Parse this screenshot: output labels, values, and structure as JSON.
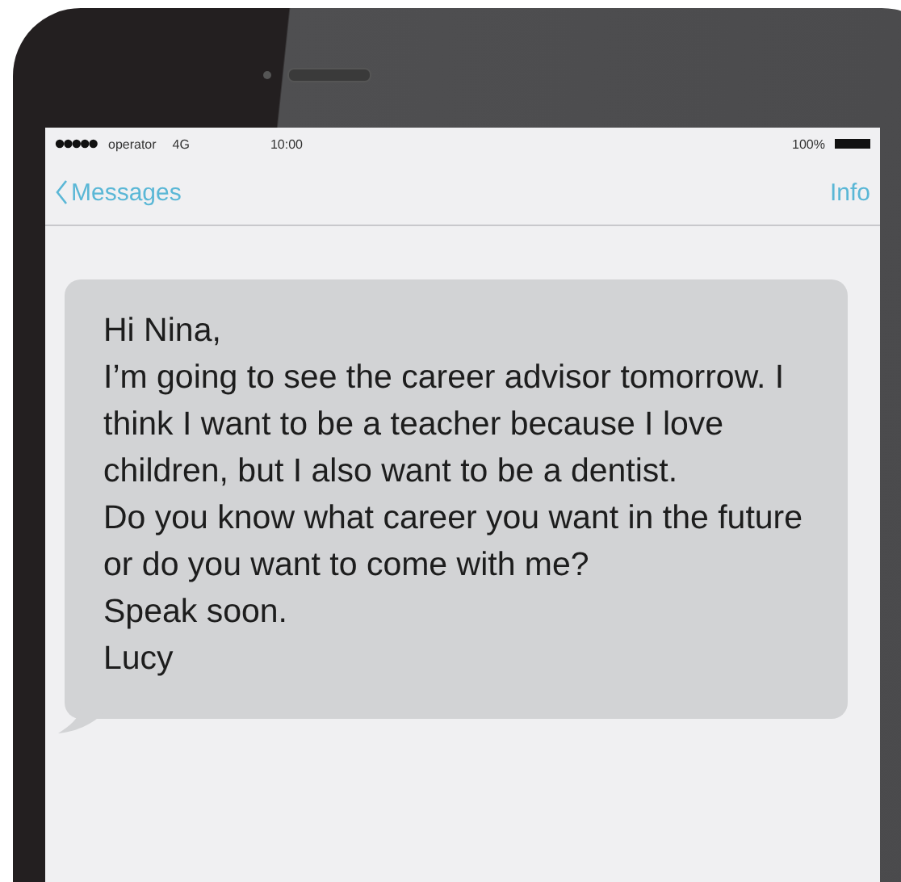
{
  "status_bar": {
    "carrier": "operator",
    "network": "4G",
    "time": "10:00",
    "battery": "100%"
  },
  "nav_bar": {
    "back_label": "Messages",
    "action": "Info"
  },
  "message": {
    "paragraphs": [
      "Hi Nina,",
      "I’m going to see the career advisor tomorrow. I think I want to be a teacher because I love children, but I also want to be a dentist.",
      "Do you know what career you want in the future or do you want to come with me?",
      "Speak soon.",
      "Lucy"
    ]
  }
}
